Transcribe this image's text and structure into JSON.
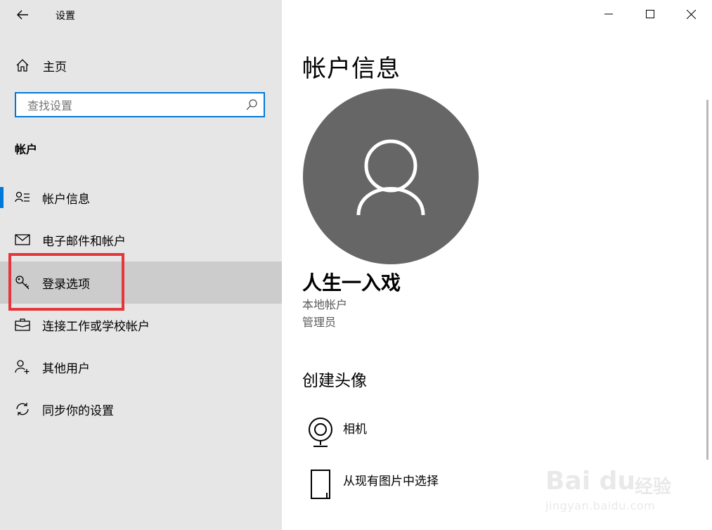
{
  "window": {
    "title": "设置",
    "controls": [
      "minimize",
      "maximize",
      "close"
    ]
  },
  "sidebar": {
    "home_label": "主页",
    "search_placeholder": "查找设置",
    "section_title": "帐户",
    "items": [
      {
        "label": "帐户信息",
        "icon": "account-info-icon",
        "selected": true
      },
      {
        "label": "电子邮件和帐户",
        "icon": "mail-icon",
        "selected": false
      },
      {
        "label": "登录选项",
        "icon": "key-icon",
        "selected": false,
        "hovered": true
      },
      {
        "label": "连接工作或学校帐户",
        "icon": "briefcase-icon",
        "selected": false
      },
      {
        "label": "其他用户",
        "icon": "add-person-icon",
        "selected": false
      },
      {
        "label": "同步你的设置",
        "icon": "sync-icon",
        "selected": false
      }
    ]
  },
  "main": {
    "page_title": "帐户信息",
    "user_name": "人生一入戏",
    "account_type": "本地帐户",
    "role": "管理员",
    "create_avatar_title": "创建头像",
    "options": [
      {
        "label": "相机",
        "icon": "camera-icon"
      },
      {
        "label": "从现有图片中选择",
        "icon": "picture-file-icon"
      }
    ]
  },
  "watermark": {
    "brand_latin": "Bai du",
    "brand_cn": "经验",
    "url": "jingyan.baidu.com"
  },
  "colors": {
    "accent": "#0078d7",
    "highlight": "#e5363b",
    "sidebar_bg": "#e6e6e6",
    "avatar_bg": "#666666"
  }
}
